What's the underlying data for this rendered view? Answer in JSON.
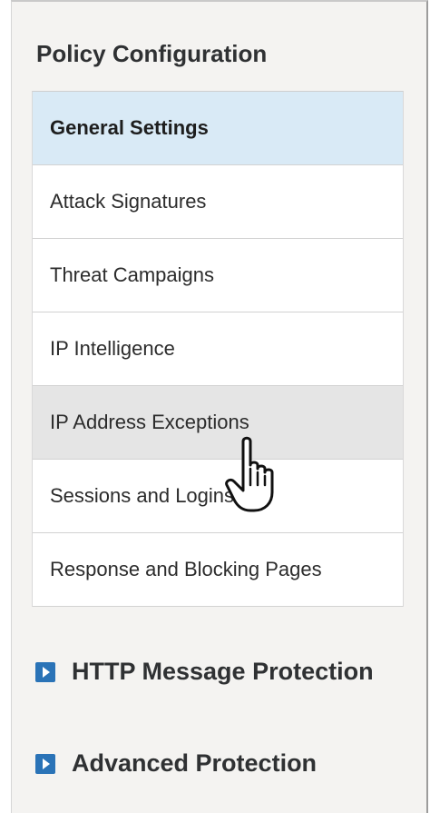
{
  "panel": {
    "title": "Policy Configuration",
    "menu_items": [
      {
        "label": "General Settings",
        "state": "active"
      },
      {
        "label": "Attack Signatures",
        "state": "normal"
      },
      {
        "label": "Threat Campaigns",
        "state": "normal"
      },
      {
        "label": "IP Intelligence",
        "state": "normal"
      },
      {
        "label": "IP Address Exceptions",
        "state": "hover"
      },
      {
        "label": "Sessions and Logins",
        "state": "normal"
      },
      {
        "label": "Response and Blocking Pages",
        "state": "normal"
      }
    ],
    "sections": [
      {
        "label": "HTTP Message Protection",
        "icon": "expand-arrow-icon"
      },
      {
        "label": "Advanced Protection",
        "icon": "expand-arrow-icon"
      }
    ]
  },
  "colors": {
    "active_bg": "#d9eaf6",
    "hover_bg": "#e5e5e5",
    "accent": "#2a73b7"
  },
  "cursor": {
    "icon": "hand-pointer-icon"
  }
}
